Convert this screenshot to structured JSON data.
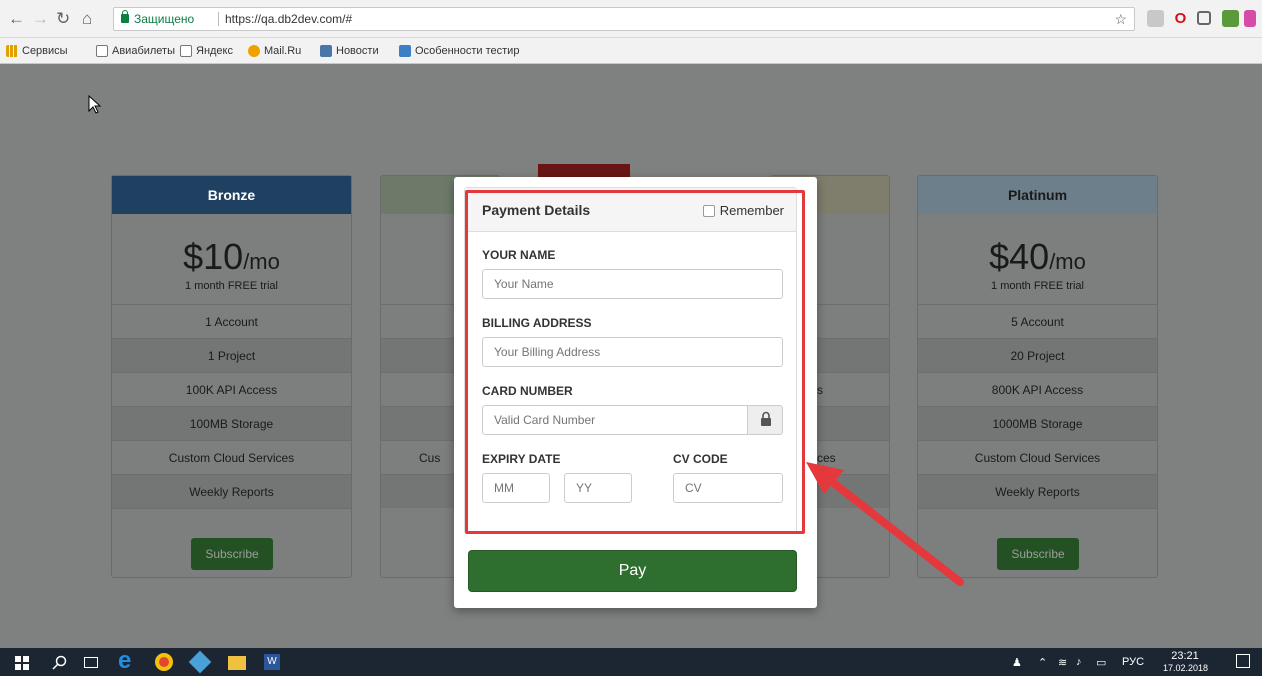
{
  "browser": {
    "secure_label": "Защищено",
    "url": "https://qa.db2dev.com/#",
    "bookmarks": [
      {
        "label": "Сервисы",
        "color": "#e0a000"
      },
      {
        "label": "Авиабилеты",
        "color": "#ffffff"
      },
      {
        "label": "Яндекс",
        "color": "#ffffff"
      },
      {
        "label": "Mail.Ru",
        "color": "#1a73e8"
      },
      {
        "label": "Новости",
        "color": "#4a76a8"
      },
      {
        "label": "Особенности тестир",
        "color": "#3b7fc4"
      }
    ]
  },
  "plans": [
    {
      "name": "Bronze",
      "price": "$10",
      "per": "/mo",
      "trial": "1 month FREE trial",
      "features": [
        "1 Account",
        "1 Project",
        "100K API Access",
        "100MB Storage",
        "Custom Cloud Services",
        "Weekly Reports"
      ],
      "button": "Subscribe",
      "header_color": "#1f4060"
    },
    {
      "name": "Platinum",
      "price": "$40",
      "per": "/mo",
      "trial": "1 month FREE trial",
      "features": [
        "5 Account",
        "20 Project",
        "800K API Access",
        "1000MB Storage",
        "Custom Cloud Services",
        "Weekly Reports"
      ],
      "button": "Subscribe",
      "header_color": "#6d7f8b"
    }
  ],
  "hidden_partial": {
    "left_feature": "Cus",
    "right_feature": "ces",
    "right_api": "s"
  },
  "modal": {
    "title": "Payment Details",
    "remember_label": "Remember",
    "name_label": "YOUR NAME",
    "name_placeholder": "Your Name",
    "address_label": "BILLING ADDRESS",
    "address_placeholder": "Your Billing Address",
    "card_label": "CARD NUMBER",
    "card_placeholder": "Valid Card Number",
    "expiry_label": "EXPIRY DATE",
    "mm_placeholder": "MM",
    "yy_placeholder": "YY",
    "cv_label": "CV CODE",
    "cv_placeholder": "CV",
    "pay_label": "Pay"
  },
  "taskbar": {
    "language": "РУС",
    "time": "23:21",
    "date": "17.02.2018"
  },
  "colors": {
    "highlight": "#e5383d",
    "pay_button": "#2e6e2e"
  }
}
